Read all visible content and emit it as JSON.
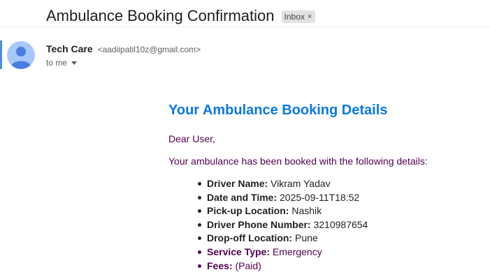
{
  "email": {
    "subject": "Ambulance Booking Confirmation",
    "label_chip": "Inbox",
    "label_chip_close": "×",
    "sender": {
      "name": "Tech Care",
      "email": "<aadiipatil10z@gmail.com>"
    },
    "to_line": "to me"
  },
  "message": {
    "heading": "Your Ambulance Booking Details",
    "greeting": "Dear User,",
    "intro": "Your ambulance has been booked with the following details:",
    "details": [
      {
        "label": "Driver Name:",
        "value": "Vikram Yadav"
      },
      {
        "label": "Date and Time:",
        "value": "2025-09-11T18:52"
      },
      {
        "label": "Pick-up Location:",
        "value": "Nashik"
      },
      {
        "label": "Driver Phone Number:",
        "value": "3210987654"
      },
      {
        "label": "Drop-off Location:",
        "value": "Pune"
      },
      {
        "label": "Service Type:",
        "value": "Emergency"
      },
      {
        "label": "Fees:",
        "value": "(Paid)"
      }
    ]
  },
  "colors": {
    "heading_blue": "#0b78e3",
    "quoted_purple": "#500050",
    "avatar_bg": "#a8c7fa",
    "avatar_fg": "#4a7fe0",
    "accent_bar": "#4a90e2"
  },
  "icons": {
    "avatar": "person-avatar-icon",
    "dropdown": "caret-down-icon",
    "chip_close": "close-icon"
  }
}
